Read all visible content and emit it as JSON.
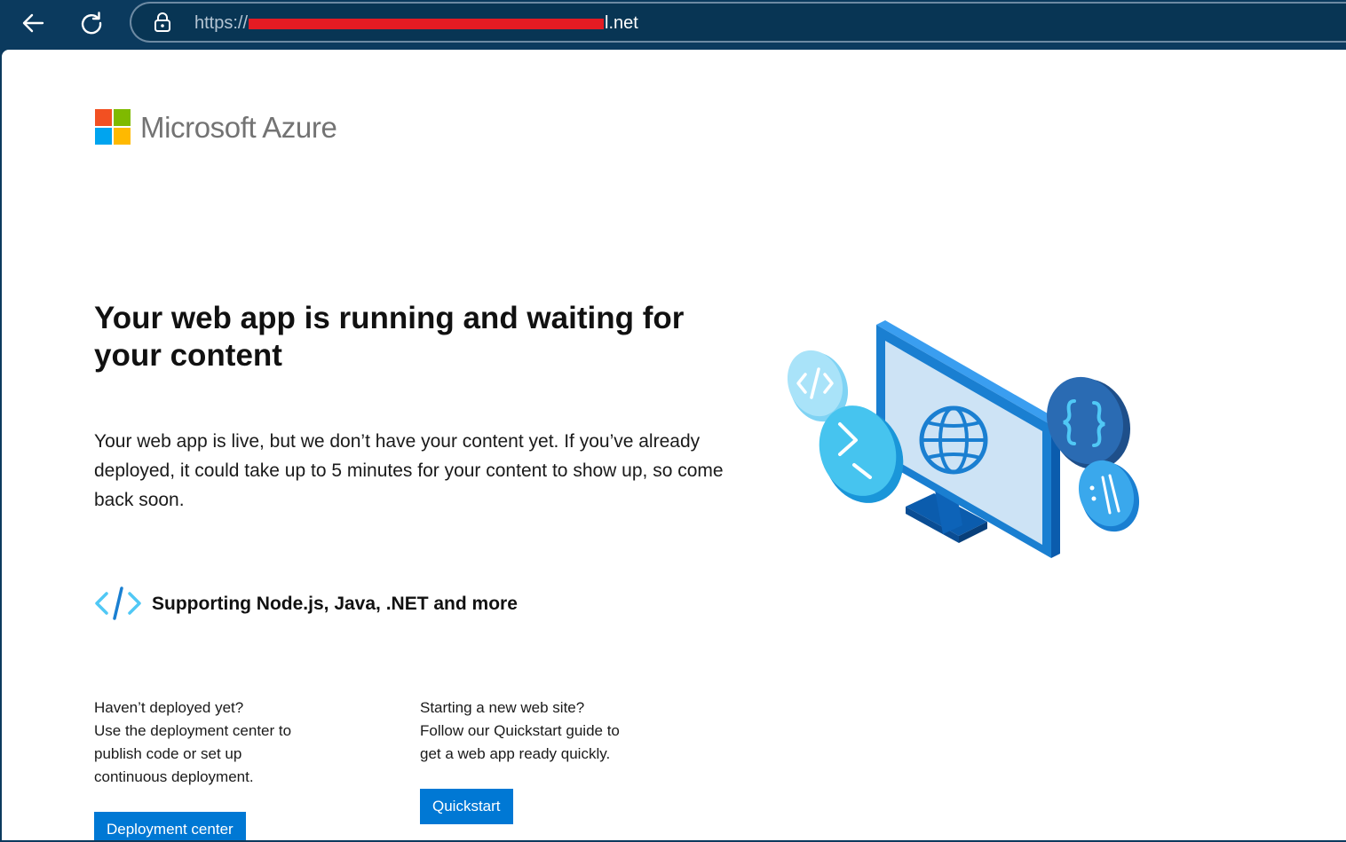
{
  "browser": {
    "url_prefix": "https://",
    "url_suffix": "l.net"
  },
  "brand": {
    "name": "Microsoft Azure",
    "colors": [
      "#f25022",
      "#7fba00",
      "#00a4ef",
      "#ffb900"
    ]
  },
  "main": {
    "headline": "Your web app is running and waiting for your content",
    "lead": "Your web app is live, but we don’t have your content yet. If you’ve already deployed, it could take up to 5 minutes for your content to show up, so come back soon.",
    "support_text": "Supporting Node.js, Java, .NET and more",
    "support_icon": "code-brackets-icon"
  },
  "columns": [
    {
      "lines": [
        "Haven’t deployed yet?",
        "Use the deployment center to",
        "publish code or set up",
        "continuous deployment."
      ],
      "button": "Deployment center"
    },
    {
      "lines": [
        "Starting a new web site?",
        "Follow our Quickstart guide to",
        "get a web app ready quickly."
      ],
      "button": "Quickstart"
    }
  ],
  "colors": {
    "accent": "#0078d4",
    "toolbar": "#0b3a5e"
  }
}
